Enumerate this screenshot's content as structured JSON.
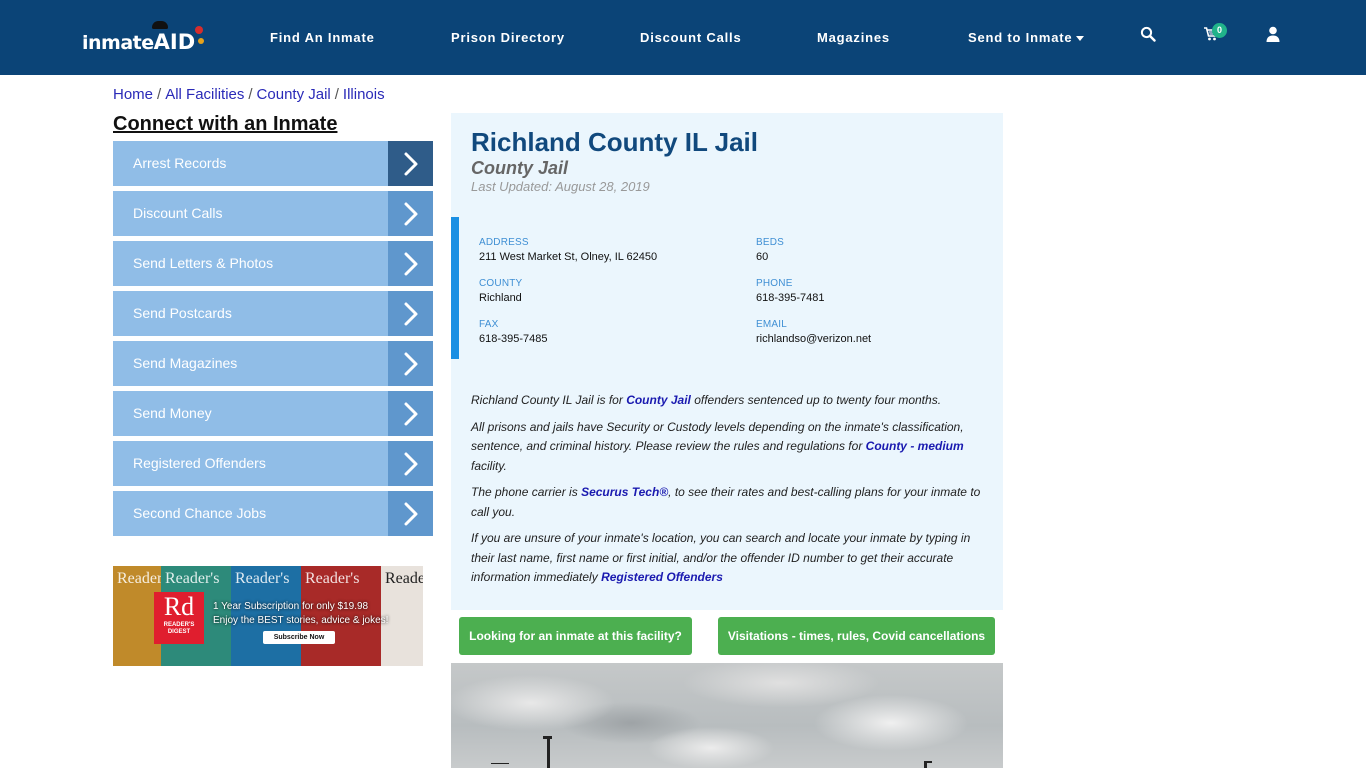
{
  "brand": {
    "logo_text": "inmate",
    "logo_accent": "AID"
  },
  "nav": {
    "links": [
      "Find An Inmate",
      "Prison Directory",
      "Discount Calls",
      "Magazines",
      "Send to Inmate"
    ],
    "cart_count": "0",
    "icons": [
      "search-icon",
      "cart-icon",
      "user-icon"
    ]
  },
  "breadcrumb": [
    "Home",
    "All Facilities",
    "County Jail",
    "Illinois"
  ],
  "sidebar": {
    "title": "Connect with an Inmate",
    "items": [
      "Arrest Records",
      "Discount Calls",
      "Send Letters & Photos",
      "Send Postcards",
      "Send Magazines",
      "Send Money",
      "Registered Offenders",
      "Second Chance Jobs"
    ]
  },
  "ad": {
    "cover_titles": [
      "Reader's",
      "Reader's",
      "Reader's",
      "Reader's",
      "Reader's"
    ],
    "logo": "Rd",
    "logo_sub": "READER'S DIGEST",
    "line1": "1 Year Subscription for only $19.98",
    "line2": "Enjoy the BEST stories, advice & jokes!",
    "button": "Subscribe Now"
  },
  "facility": {
    "name": "Richland County IL Jail",
    "type": "County Jail",
    "last_updated": "Last Updated: August 28, 2019",
    "info": {
      "address_label": "ADDRESS",
      "address": "211 West Market St, Olney, IL 62450",
      "beds_label": "BEDS",
      "beds": "60",
      "county_label": "COUNTY",
      "county": "Richland",
      "phone_label": "PHONE",
      "phone": "618-395-7481",
      "fax_label": "FAX",
      "fax": "618-395-7485",
      "email_label": "EMAIL",
      "email": "richlandso@verizon.net"
    },
    "description": {
      "p1_pre": "Richland County IL Jail is for ",
      "p1_link": "County Jail",
      "p1_post": " offenders sentenced up to twenty four months.",
      "p2_pre": "All prisons and jails have Security or Custody levels depending on the inmate's classification, sentence, and criminal history. Please review the rules and regulations for ",
      "p2_link": "County - medium",
      "p2_post": " facility.",
      "p3_pre": "The phone carrier is ",
      "p3_link": "Securus Tech®",
      "p3_post": ", to see their rates and best-calling plans for your inmate to call you.",
      "p4_pre": "If you are unsure of your inmate's location, you can search and locate your inmate by typing in their last name, first name or first initial, and/or the offender ID number to get their accurate information immediately ",
      "p4_link": "Registered Offenders"
    },
    "buttons": {
      "find_inmate": "Looking for an inmate at this facility?",
      "visitations": "Visitations - times, rules, Covid cancellations"
    }
  }
}
